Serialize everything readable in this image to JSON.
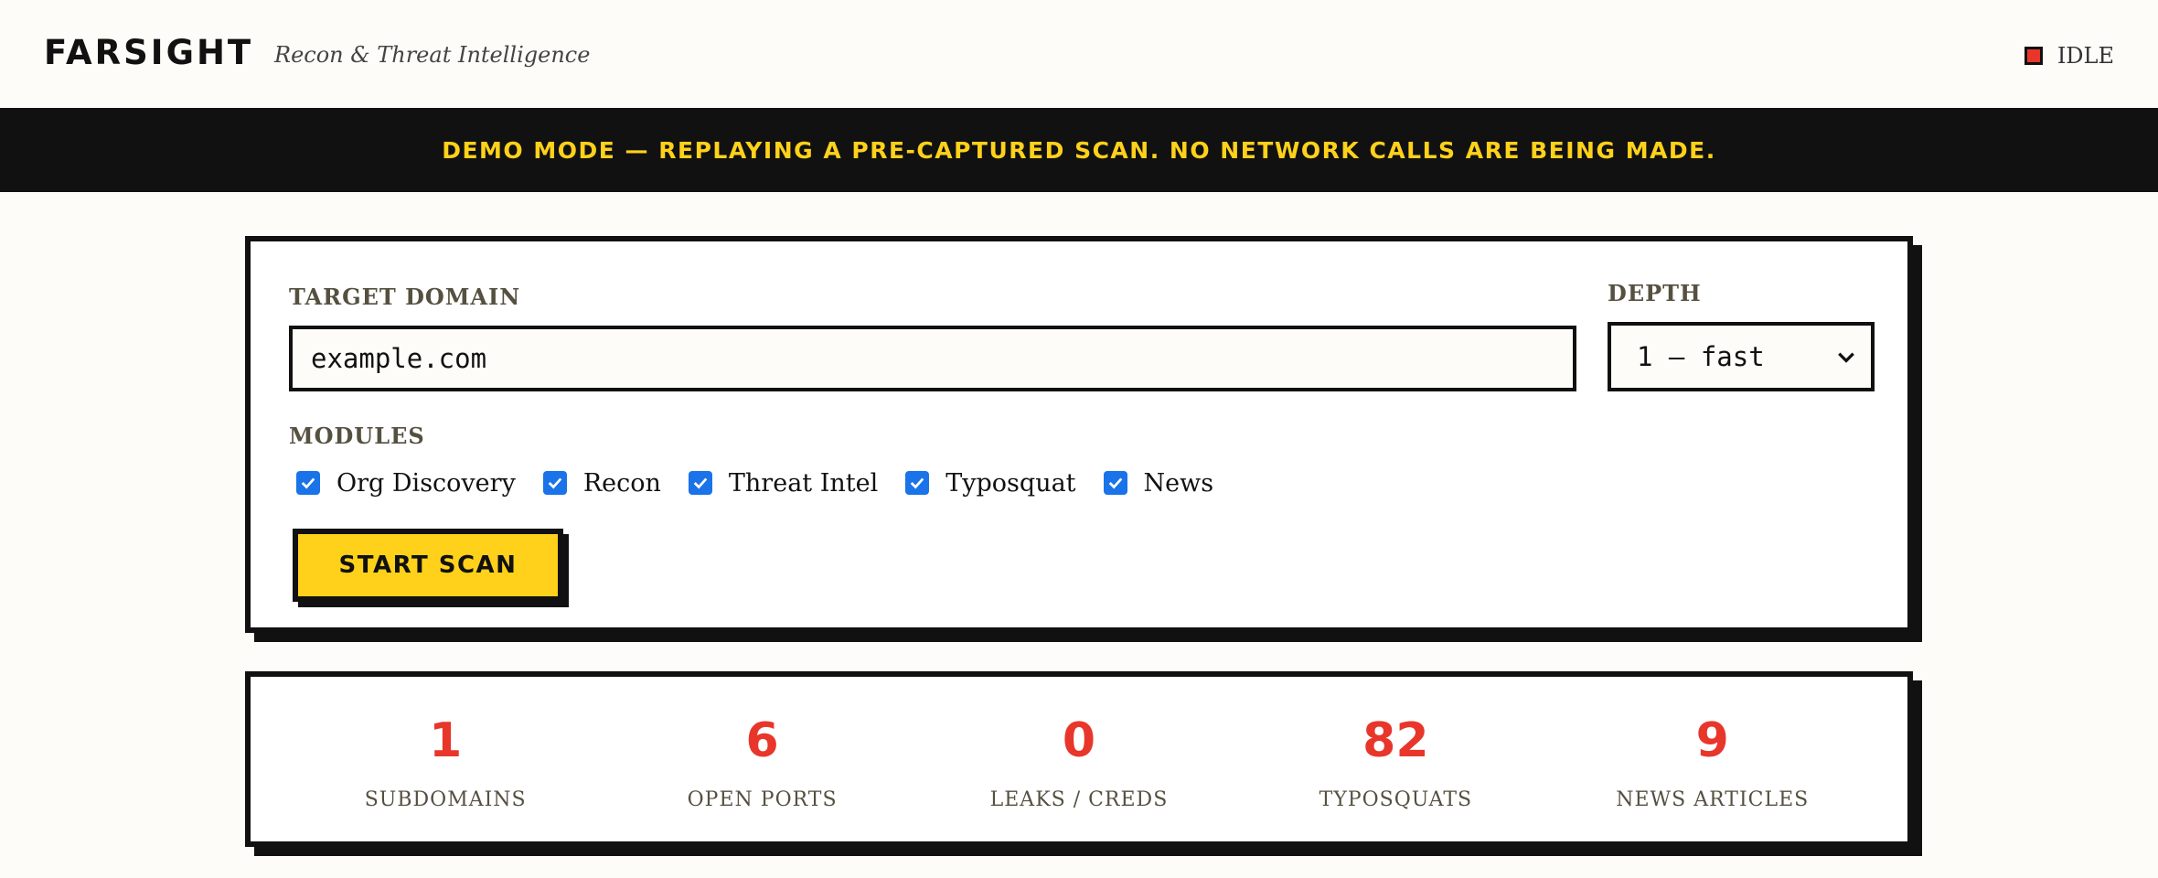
{
  "header": {
    "brand": "FARSIGHT",
    "tagline": "Recon & Threat Intelligence",
    "status": "IDLE",
    "status_color": "#e8362b"
  },
  "banner": {
    "text": "DEMO MODE — REPLAYING A PRE-CAPTURED SCAN. NO NETWORK CALLS ARE BEING MADE."
  },
  "scan_form": {
    "target_label": "TARGET DOMAIN",
    "target_value": "example.com",
    "depth_label": "DEPTH",
    "depth_value": "1 — fast",
    "modules_label": "MODULES",
    "modules": [
      {
        "label": "Org Discovery",
        "checked": true
      },
      {
        "label": "Recon",
        "checked": true
      },
      {
        "label": "Threat Intel",
        "checked": true
      },
      {
        "label": "Typosquat",
        "checked": true
      },
      {
        "label": "News",
        "checked": true
      }
    ],
    "start_label": "START SCAN"
  },
  "stats": [
    {
      "value": "1",
      "label": "SUBDOMAINS"
    },
    {
      "value": "6",
      "label": "OPEN PORTS"
    },
    {
      "value": "0",
      "label": "LEAKS / CREDS"
    },
    {
      "value": "82",
      "label": "TYPOSQUATS"
    },
    {
      "value": "9",
      "label": "NEWS ARTICLES"
    }
  ],
  "colors": {
    "accent": "#ffd11a",
    "danger": "#e8362b",
    "ink": "#111111",
    "checkbox": "#1a73e8",
    "background": "#fdfcf8"
  }
}
